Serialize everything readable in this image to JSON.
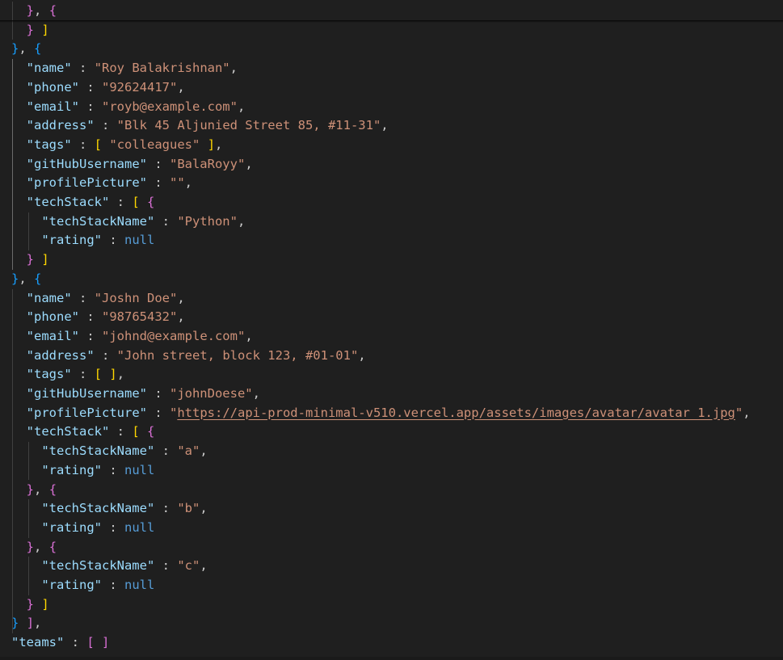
{
  "editor": {
    "language": "json",
    "colors": {
      "background": "#1f1f1f",
      "key": "#9cdcfe",
      "string": "#ce9178",
      "null": "#569cd6",
      "bracket_level_1": "#ffd700",
      "bracket_level_2": "#da70d6",
      "bracket_level_3": "#179fff"
    },
    "lines": [
      [
        [
          "  ",
          "punc"
        ],
        [
          "}",
          "b2"
        ],
        [
          ", ",
          "punc"
        ],
        [
          "{",
          "b2"
        ]
      ],
      [
        [
          "  ",
          "punc"
        ],
        [
          "}",
          "b2"
        ],
        [
          " ",
          "punc"
        ],
        [
          "]",
          "b1"
        ]
      ],
      [
        [
          "}",
          "b3"
        ],
        [
          ", ",
          "punc"
        ],
        [
          "{",
          "b3"
        ]
      ],
      [
        [
          "  ",
          "punc"
        ],
        [
          "\"name\"",
          "key"
        ],
        [
          " : ",
          "punc"
        ],
        [
          "\"Roy Balakrishnan\"",
          "str"
        ],
        [
          ",",
          "punc"
        ]
      ],
      [
        [
          "  ",
          "punc"
        ],
        [
          "\"phone\"",
          "key"
        ],
        [
          " : ",
          "punc"
        ],
        [
          "\"92624417\"",
          "str"
        ],
        [
          ",",
          "punc"
        ]
      ],
      [
        [
          "  ",
          "punc"
        ],
        [
          "\"email\"",
          "key"
        ],
        [
          " : ",
          "punc"
        ],
        [
          "\"royb@example.com\"",
          "str"
        ],
        [
          ",",
          "punc"
        ]
      ],
      [
        [
          "  ",
          "punc"
        ],
        [
          "\"address\"",
          "key"
        ],
        [
          " : ",
          "punc"
        ],
        [
          "\"Blk 45 Aljunied Street 85, #11-31\"",
          "str"
        ],
        [
          ",",
          "punc"
        ]
      ],
      [
        [
          "  ",
          "punc"
        ],
        [
          "\"tags\"",
          "key"
        ],
        [
          " : ",
          "punc"
        ],
        [
          "[",
          "b1"
        ],
        [
          " ",
          "punc"
        ],
        [
          "\"colleagues\"",
          "str"
        ],
        [
          " ",
          "punc"
        ],
        [
          "]",
          "b1"
        ],
        [
          ",",
          "punc"
        ]
      ],
      [
        [
          "  ",
          "punc"
        ],
        [
          "\"gitHubUsername\"",
          "key"
        ],
        [
          " : ",
          "punc"
        ],
        [
          "\"BalaRoyy\"",
          "str"
        ],
        [
          ",",
          "punc"
        ]
      ],
      [
        [
          "  ",
          "punc"
        ],
        [
          "\"profilePicture\"",
          "key"
        ],
        [
          " : ",
          "punc"
        ],
        [
          "\"\"",
          "str"
        ],
        [
          ",",
          "punc"
        ]
      ],
      [
        [
          "  ",
          "punc"
        ],
        [
          "\"techStack\"",
          "key"
        ],
        [
          " : ",
          "punc"
        ],
        [
          "[",
          "b1"
        ],
        [
          " ",
          "punc"
        ],
        [
          "{",
          "b2"
        ]
      ],
      [
        [
          "    ",
          "punc"
        ],
        [
          "\"techStackName\"",
          "key"
        ],
        [
          " : ",
          "punc"
        ],
        [
          "\"Python\"",
          "str"
        ],
        [
          ",",
          "punc"
        ]
      ],
      [
        [
          "    ",
          "punc"
        ],
        [
          "\"rating\"",
          "key"
        ],
        [
          " : ",
          "punc"
        ],
        [
          "null",
          "nul"
        ]
      ],
      [
        [
          "  ",
          "punc"
        ],
        [
          "}",
          "b2"
        ],
        [
          " ",
          "punc"
        ],
        [
          "]",
          "b1"
        ]
      ],
      [
        [
          "}",
          "b3"
        ],
        [
          ", ",
          "punc"
        ],
        [
          "{",
          "b3"
        ]
      ],
      [
        [
          "  ",
          "punc"
        ],
        [
          "\"name\"",
          "key"
        ],
        [
          " : ",
          "punc"
        ],
        [
          "\"Joshn Doe\"",
          "str"
        ],
        [
          ",",
          "punc"
        ]
      ],
      [
        [
          "  ",
          "punc"
        ],
        [
          "\"phone\"",
          "key"
        ],
        [
          " : ",
          "punc"
        ],
        [
          "\"98765432\"",
          "str"
        ],
        [
          ",",
          "punc"
        ]
      ],
      [
        [
          "  ",
          "punc"
        ],
        [
          "\"email\"",
          "key"
        ],
        [
          " : ",
          "punc"
        ],
        [
          "\"johnd@example.com\"",
          "str"
        ],
        [
          ",",
          "punc"
        ]
      ],
      [
        [
          "  ",
          "punc"
        ],
        [
          "\"address\"",
          "key"
        ],
        [
          " : ",
          "punc"
        ],
        [
          "\"John street, block 123, #01-01\"",
          "str"
        ],
        [
          ",",
          "punc"
        ]
      ],
      [
        [
          "  ",
          "punc"
        ],
        [
          "\"tags\"",
          "key"
        ],
        [
          " : ",
          "punc"
        ],
        [
          "[",
          "b1"
        ],
        [
          " ",
          "punc"
        ],
        [
          "]",
          "b1"
        ],
        [
          ",",
          "punc"
        ]
      ],
      [
        [
          "  ",
          "punc"
        ],
        [
          "\"gitHubUsername\"",
          "key"
        ],
        [
          " : ",
          "punc"
        ],
        [
          "\"johnDoese\"",
          "str"
        ],
        [
          ",",
          "punc"
        ]
      ],
      [
        [
          "  ",
          "punc"
        ],
        [
          "\"profilePicture\"",
          "key"
        ],
        [
          " : ",
          "punc"
        ],
        [
          "\"",
          "str"
        ],
        [
          "https://api-prod-minimal-v510.vercel.app/assets/images/avatar/avatar_1.jpg",
          "url"
        ],
        [
          "\"",
          "str"
        ],
        [
          ",",
          "punc"
        ]
      ],
      [
        [
          "  ",
          "punc"
        ],
        [
          "\"techStack\"",
          "key"
        ],
        [
          " : ",
          "punc"
        ],
        [
          "[",
          "b1"
        ],
        [
          " ",
          "punc"
        ],
        [
          "{",
          "b2"
        ]
      ],
      [
        [
          "    ",
          "punc"
        ],
        [
          "\"techStackName\"",
          "key"
        ],
        [
          " : ",
          "punc"
        ],
        [
          "\"a\"",
          "str"
        ],
        [
          ",",
          "punc"
        ]
      ],
      [
        [
          "    ",
          "punc"
        ],
        [
          "\"rating\"",
          "key"
        ],
        [
          " : ",
          "punc"
        ],
        [
          "null",
          "nul"
        ]
      ],
      [
        [
          "  ",
          "punc"
        ],
        [
          "}",
          "b2"
        ],
        [
          ", ",
          "punc"
        ],
        [
          "{",
          "b2"
        ]
      ],
      [
        [
          "    ",
          "punc"
        ],
        [
          "\"techStackName\"",
          "key"
        ],
        [
          " : ",
          "punc"
        ],
        [
          "\"b\"",
          "str"
        ],
        [
          ",",
          "punc"
        ]
      ],
      [
        [
          "    ",
          "punc"
        ],
        [
          "\"rating\"",
          "key"
        ],
        [
          " : ",
          "punc"
        ],
        [
          "null",
          "nul"
        ]
      ],
      [
        [
          "  ",
          "punc"
        ],
        [
          "}",
          "b2"
        ],
        [
          ", ",
          "punc"
        ],
        [
          "{",
          "b2"
        ]
      ],
      [
        [
          "    ",
          "punc"
        ],
        [
          "\"techStackName\"",
          "key"
        ],
        [
          " : ",
          "punc"
        ],
        [
          "\"c\"",
          "str"
        ],
        [
          ",",
          "punc"
        ]
      ],
      [
        [
          "    ",
          "punc"
        ],
        [
          "\"rating\"",
          "key"
        ],
        [
          " : ",
          "punc"
        ],
        [
          "null",
          "nul"
        ]
      ],
      [
        [
          "  ",
          "punc"
        ],
        [
          "}",
          "b2"
        ],
        [
          " ",
          "punc"
        ],
        [
          "]",
          "b1"
        ]
      ],
      [
        [
          "}",
          "b3"
        ],
        [
          " ",
          "punc"
        ],
        [
          "]",
          "b2"
        ],
        [
          ",",
          "punc"
        ]
      ],
      [
        [
          "\"teams\"",
          "key"
        ],
        [
          " : ",
          "punc"
        ],
        [
          "[",
          "b2"
        ],
        [
          " ",
          "punc"
        ],
        [
          "]",
          "b2"
        ]
      ]
    ]
  }
}
